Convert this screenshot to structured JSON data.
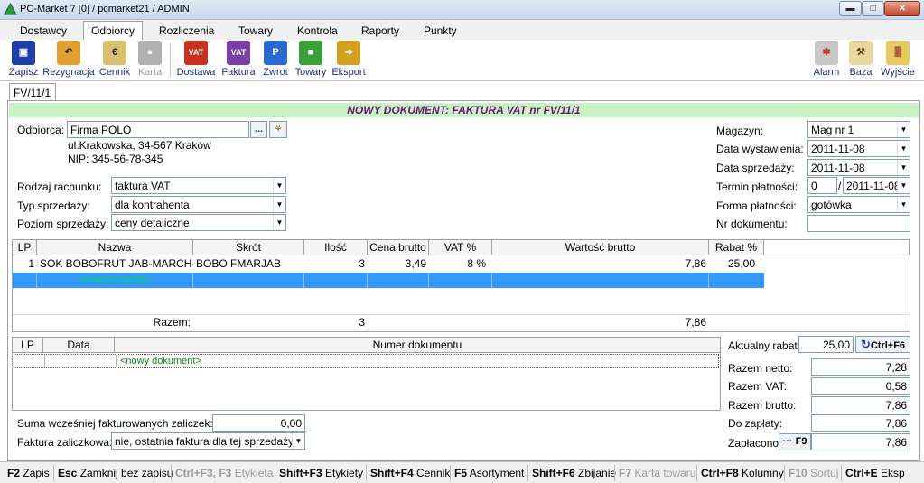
{
  "window": {
    "title": "PC-Market 7 [0] / pcmarket21 / ADMIN"
  },
  "menu": [
    "Dostawcy",
    "Odbiorcy",
    "Rozliczenia",
    "Towary",
    "Kontrola",
    "Raporty",
    "Punkty"
  ],
  "toolbar": {
    "zapisz": "Zapisz",
    "rezygnacja": "Rezygnacja",
    "cennik": "Cennik",
    "karta": "Karta",
    "dostawa": "Dostawa",
    "faktura": "Faktura",
    "zwrot": "Zwrot",
    "towary": "Towary",
    "eksport": "Eksport",
    "alarm": "Alarm",
    "baza": "Baza",
    "wyjscie": "Wyjście",
    "icon_vat": "VAT",
    "icon_p": "P"
  },
  "doc_tab": "FV/11/1",
  "banner": "NOWY DOKUMENT: FAKTURA VAT nr FV/11/1",
  "customer": {
    "label": "Odbiorca:",
    "name": "Firma POLO",
    "address": "ul.Krakowska, 34-567 Kraków",
    "nip": "NIP: 345-56-78-345",
    "more": "..."
  },
  "left_form": {
    "rodzaj_label": "Rodzaj rachunku:",
    "rodzaj_value": "faktura VAT",
    "typ_label": "Typ sprzedaży:",
    "typ_value": "dla kontrahenta",
    "poziom_label": "Poziom sprzedaży:",
    "poziom_value": "ceny detaliczne"
  },
  "right_form": {
    "magazyn_label": "Magazyn:",
    "magazyn_value": "Mag nr 1",
    "wyst_label": "Data wystawienia:",
    "wyst_value": "2011-11-08",
    "sprz_label": "Data sprzedaży:",
    "sprz_value": "2011-11-08",
    "termin_label": "Termin płatności:",
    "termin_days": "0",
    "termin_slash": "/",
    "termin_date": "2011-11-08",
    "forma_label": "Forma płatności:",
    "forma_value": "gotówka",
    "nrdok_label": "Nr dokumentu:",
    "nrdok_value": ""
  },
  "items": {
    "headers": [
      "LP",
      "Nazwa",
      "Skrót",
      "Ilość",
      "Cena brutto",
      "VAT %",
      "Wartość brutto",
      "Rabat %"
    ],
    "row1": {
      "lp": "1",
      "nazwa": "SOK BOBOFRUT JAB-MARCH-B",
      "skrot": "BOBO FMARJAB",
      "ilosc": "3",
      "cena": "3,49",
      "vat": "8 %",
      "wartosc": "7,86",
      "rabat": "25,00"
    },
    "new_position": "<nowa pozycja>",
    "sum_label": "Razem:",
    "sum_qty": "3",
    "sum_value": "7,86"
  },
  "prev_docs": {
    "headers": [
      "LP",
      "Data",
      "Numer dokumentu"
    ],
    "new_doc": "<nowy dokument>"
  },
  "advances": {
    "suma_label": "Suma wcześniej fakturowanych zaliczek:",
    "suma_value": "0,00",
    "fz_label": "Faktura zaliczkowa:",
    "fz_value": "nie, ostatnia faktura dla tej sprzedaży"
  },
  "totals": {
    "rabat_label": "Aktualny rabat:",
    "rabat_value": "25,00",
    "rabat_btn": "Ctrl+F6",
    "netto_label": "Razem netto:",
    "netto_value": "7,28",
    "vat_label": "Razem VAT:",
    "vat_value": "0,58",
    "brutto_label": "Razem brutto:",
    "brutto_value": "7,86",
    "doz_label": "Do zapłaty:",
    "doz_value": "7,86",
    "zapl_label": "Zapłacono:",
    "zapl_btn_dots": "···",
    "zapl_btn_key": "F9",
    "zapl_value": "7,86"
  },
  "statusbar": [
    {
      "key": "F2",
      "label": "Zapis",
      "enabled": true
    },
    {
      "key": "Esc",
      "label": "Zamknij bez zapisu",
      "enabled": true
    },
    {
      "key": "Ctrl+F3, F3",
      "label": "Etykieta",
      "enabled": false
    },
    {
      "key": "Shift+F3",
      "label": "Etykiety",
      "enabled": true
    },
    {
      "key": "Shift+F4",
      "label": "Cennik",
      "enabled": true
    },
    {
      "key": "F5",
      "label": "Asortyment",
      "enabled": true
    },
    {
      "key": "Shift+F6",
      "label": "Zbijanie",
      "enabled": true
    },
    {
      "key": "F7",
      "label": "Karta towaru",
      "enabled": false
    },
    {
      "key": "Ctrl+F8",
      "label": "Kolumny",
      "enabled": true
    },
    {
      "key": "F10",
      "label": "Sortuj",
      "enabled": false
    },
    {
      "key": "Ctrl+E",
      "label": "Eksp",
      "enabled": true
    }
  ],
  "colors": {
    "banner_bg": "#c6f2c6",
    "banner_text": "#6a1a6a",
    "selected_row": "#3399ff",
    "new_row_text": "#00dd44"
  }
}
